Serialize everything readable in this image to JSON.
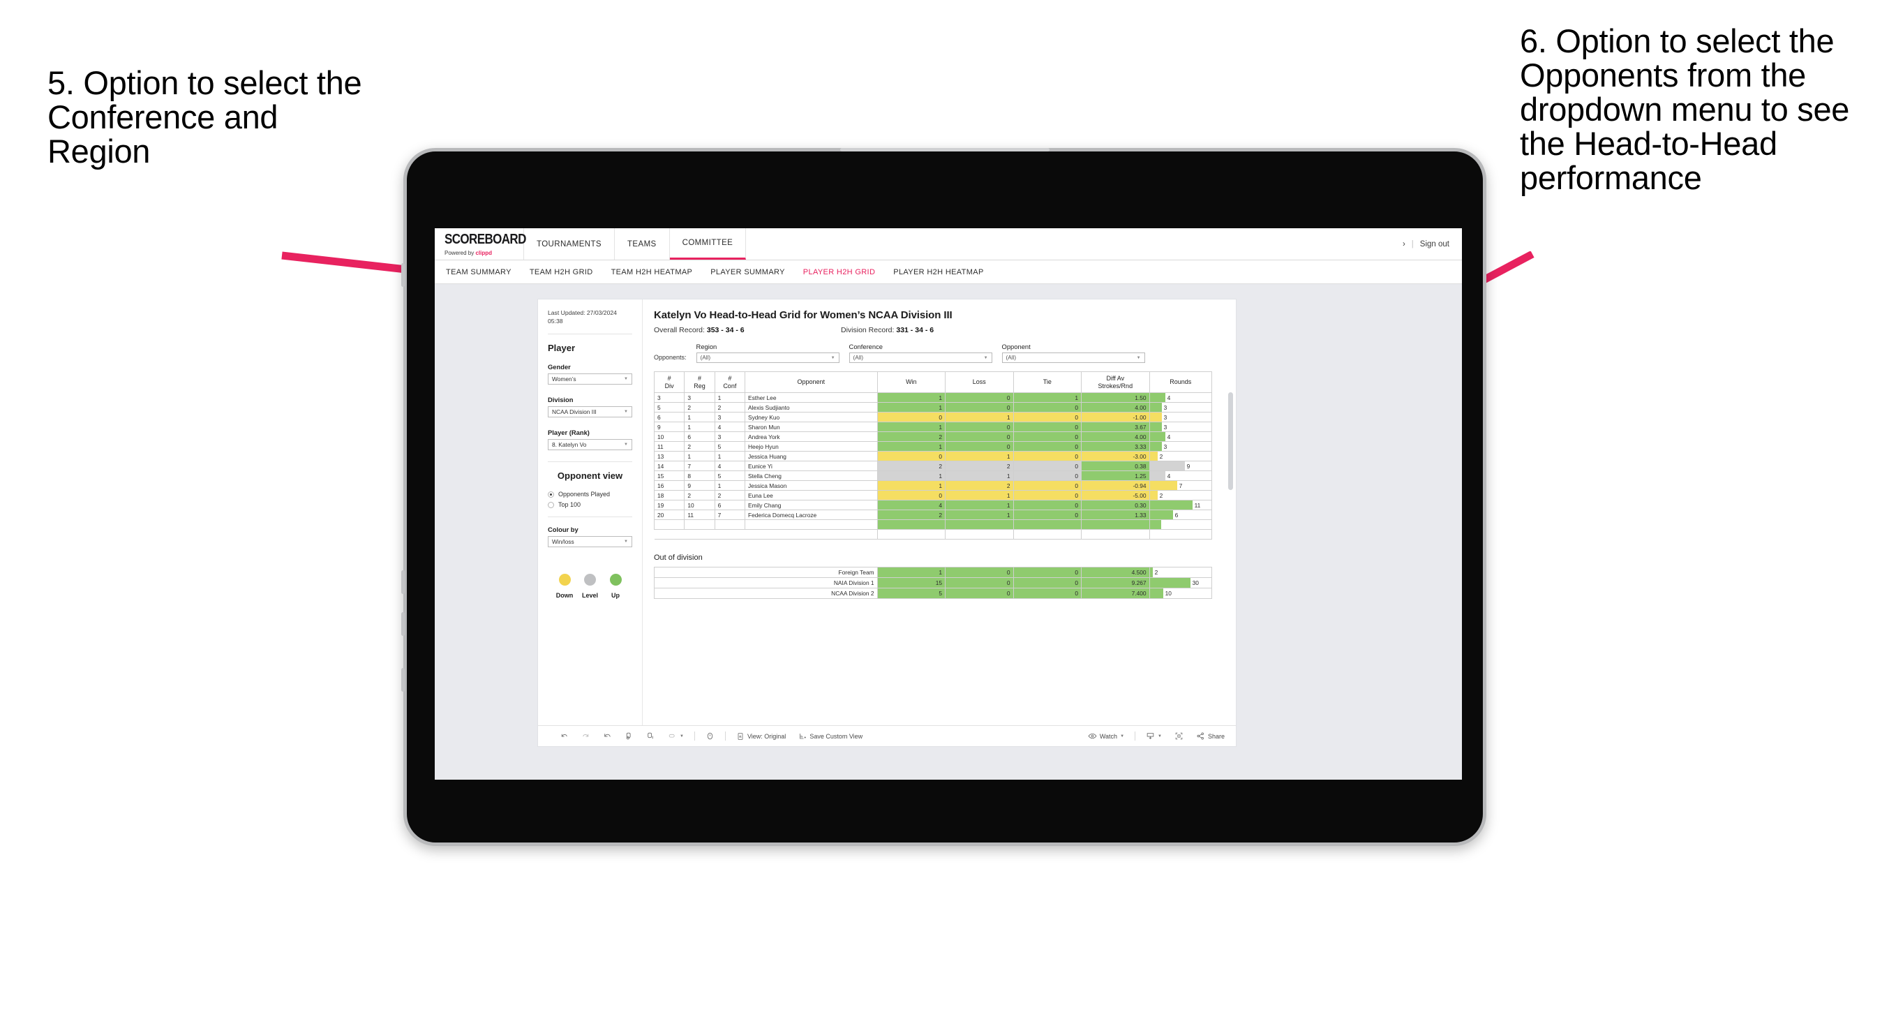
{
  "annotations": {
    "left": "5. Option to select the Conference and Region",
    "right": "6. Option to select the Opponents from the dropdown menu to see the Head-to-Head performance"
  },
  "app": {
    "brand": {
      "wordmark": "SCOREBOARD",
      "powered_prefix": "Powered by ",
      "powered_name": "clippd"
    },
    "topnav": [
      {
        "label": "TOURNAMENTS",
        "active": false
      },
      {
        "label": "TEAMS",
        "active": false
      },
      {
        "label": "COMMITTEE",
        "active": true
      }
    ],
    "header_right": {
      "chevron": "›",
      "divider": "|",
      "sign_out": "Sign out"
    },
    "subnav": [
      {
        "label": "TEAM SUMMARY",
        "active": false
      },
      {
        "label": "TEAM H2H GRID",
        "active": false
      },
      {
        "label": "TEAM H2H HEATMAP",
        "active": false
      },
      {
        "label": "PLAYER SUMMARY",
        "active": false
      },
      {
        "label": "PLAYER H2H GRID",
        "active": true
      },
      {
        "label": "PLAYER H2H HEATMAP",
        "active": false
      }
    ]
  },
  "sidebar": {
    "last_updated": "Last Updated: 27/03/2024 05:38",
    "player_section_title": "Player",
    "gender": {
      "label": "Gender",
      "value": "Women’s"
    },
    "division": {
      "label": "Division",
      "value": "NCAA Division III"
    },
    "player_rank": {
      "label": "Player (Rank)",
      "value": "8. Katelyn Vo"
    },
    "opponent_view": {
      "title": "Opponent view",
      "options": [
        {
          "label": "Opponents Played",
          "selected": true
        },
        {
          "label": "Top 100",
          "selected": false
        }
      ]
    },
    "colour_by": {
      "label": "Colour by",
      "value": "Win/loss"
    },
    "legend": [
      {
        "label": "Down",
        "color": "#f2d34e"
      },
      {
        "label": "Level",
        "color": "#bfc0c2"
      },
      {
        "label": "Up",
        "color": "#7fc15e"
      }
    ]
  },
  "view": {
    "title": "Katelyn Vo Head-to-Head Grid for Women’s NCAA Division III",
    "overall_record_label": "Overall Record:",
    "overall_record_value": "353 - 34 - 6",
    "division_record_label": "Division Record:",
    "division_record_value": "331 - 34 - 6",
    "opponents_label": "Opponents:",
    "filters": [
      {
        "label": "Region",
        "value": "(All)"
      },
      {
        "label": "Conference",
        "value": "(All)"
      },
      {
        "label": "Opponent",
        "value": "(All)"
      }
    ]
  },
  "chart_data": {
    "type": "table",
    "title": "Katelyn Vo Head-to-Head Grid for Women’s NCAA Division III",
    "columns": [
      "# Div",
      "# Reg",
      "# Conf",
      "Opponent",
      "Win",
      "Loss",
      "Tie",
      "Diff Av Strokes/Rnd",
      "Rounds"
    ],
    "column_headers_multiline": [
      [
        "#",
        "Div"
      ],
      [
        "#",
        "Reg"
      ],
      [
        "#",
        "Conf"
      ],
      [
        "Opponent"
      ],
      [
        "Win"
      ],
      [
        "Loss"
      ],
      [
        "Tie"
      ],
      [
        "Diff Av",
        "Strokes/Rnd"
      ],
      [
        "Rounds"
      ]
    ],
    "rounds_max": 12,
    "rows": [
      {
        "div": "3",
        "reg": "3",
        "conf": "1",
        "opponent": "Esther Lee",
        "win": "1",
        "loss": "0",
        "tie": "1",
        "diff": "1.50",
        "rounds": "4",
        "state": "up"
      },
      {
        "div": "5",
        "reg": "2",
        "conf": "2",
        "opponent": "Alexis Sudjianto",
        "win": "1",
        "loss": "0",
        "tie": "0",
        "diff": "4.00",
        "rounds": "3",
        "state": "up"
      },
      {
        "div": "6",
        "reg": "1",
        "conf": "3",
        "opponent": "Sydney Kuo",
        "win": "0",
        "loss": "1",
        "tie": "0",
        "diff": "-1.00",
        "rounds": "3",
        "state": "down"
      },
      {
        "div": "9",
        "reg": "1",
        "conf": "4",
        "opponent": "Sharon Mun",
        "win": "1",
        "loss": "0",
        "tie": "0",
        "diff": "3.67",
        "rounds": "3",
        "state": "up"
      },
      {
        "div": "10",
        "reg": "6",
        "conf": "3",
        "opponent": "Andrea York",
        "win": "2",
        "loss": "0",
        "tie": "0",
        "diff": "4.00",
        "rounds": "4",
        "state": "up"
      },
      {
        "div": "11",
        "reg": "2",
        "conf": "5",
        "opponent": "Heejo Hyun",
        "win": "1",
        "loss": "0",
        "tie": "0",
        "diff": "3.33",
        "rounds": "3",
        "state": "up"
      },
      {
        "div": "13",
        "reg": "1",
        "conf": "1",
        "opponent": "Jessica Huang",
        "win": "0",
        "loss": "1",
        "tie": "0",
        "diff": "-3.00",
        "rounds": "2",
        "state": "down"
      },
      {
        "div": "14",
        "reg": "7",
        "conf": "4",
        "opponent": "Eunice Yi",
        "win": "2",
        "loss": "2",
        "tie": "0",
        "diff": "0.38",
        "rounds": "9",
        "state": "level",
        "diff_state": "up"
      },
      {
        "div": "15",
        "reg": "8",
        "conf": "5",
        "opponent": "Stella Cheng",
        "win": "1",
        "loss": "1",
        "tie": "0",
        "diff": "1.25",
        "rounds": "4",
        "state": "level",
        "diff_state": "up"
      },
      {
        "div": "16",
        "reg": "9",
        "conf": "1",
        "opponent": "Jessica Mason",
        "win": "1",
        "loss": "2",
        "tie": "0",
        "diff": "-0.94",
        "rounds": "7",
        "state": "down"
      },
      {
        "div": "18",
        "reg": "2",
        "conf": "2",
        "opponent": "Euna Lee",
        "win": "0",
        "loss": "1",
        "tie": "0",
        "diff": "-5.00",
        "rounds": "2",
        "state": "down"
      },
      {
        "div": "19",
        "reg": "10",
        "conf": "6",
        "opponent": "Emily Chang",
        "win": "4",
        "loss": "1",
        "tie": "0",
        "diff": "0.30",
        "rounds": "11",
        "state": "up"
      },
      {
        "div": "20",
        "reg": "11",
        "conf": "7",
        "opponent": "Federica Domecq Lacroze",
        "win": "2",
        "loss": "1",
        "tie": "0",
        "diff": "1.33",
        "rounds": "6",
        "state": "up"
      }
    ],
    "out_of_division_title": "Out of division",
    "out_of_division_rows": [
      {
        "name": "Foreign Team",
        "win": "1",
        "loss": "0",
        "tie": "0",
        "diff": "4.500",
        "rounds": "2",
        "state": "up"
      },
      {
        "name": "NAIA Division 1",
        "win": "15",
        "loss": "0",
        "tie": "0",
        "diff": "9.267",
        "rounds": "30",
        "state": "up"
      },
      {
        "name": "NCAA Division 2",
        "win": "5",
        "loss": "0",
        "tie": "0",
        "diff": "7.400",
        "rounds": "10",
        "state": "up"
      }
    ],
    "ood_rounds_max": 34,
    "colors": {
      "up": "#8fcb6e",
      "down": "#f5de62",
      "level": "#d3d3d3",
      "accent": "#e8225f"
    }
  },
  "bottom_toolbar": {
    "items": [
      {
        "name": "undo",
        "label": ""
      },
      {
        "name": "redo",
        "label": ""
      },
      {
        "name": "revert",
        "label": ""
      },
      {
        "name": "refresh",
        "label": ""
      },
      {
        "name": "pause",
        "label": ""
      },
      {
        "name": "highlight",
        "label": ""
      },
      {
        "name": "alert",
        "label": ""
      },
      {
        "name": "view-original",
        "label": "View: Original"
      },
      {
        "name": "save-custom-view",
        "label": "Save Custom View"
      },
      {
        "name": "watch",
        "label": "Watch"
      },
      {
        "name": "download",
        "label": ""
      },
      {
        "name": "fullscreen",
        "label": ""
      },
      {
        "name": "share",
        "label": "Share"
      }
    ]
  }
}
